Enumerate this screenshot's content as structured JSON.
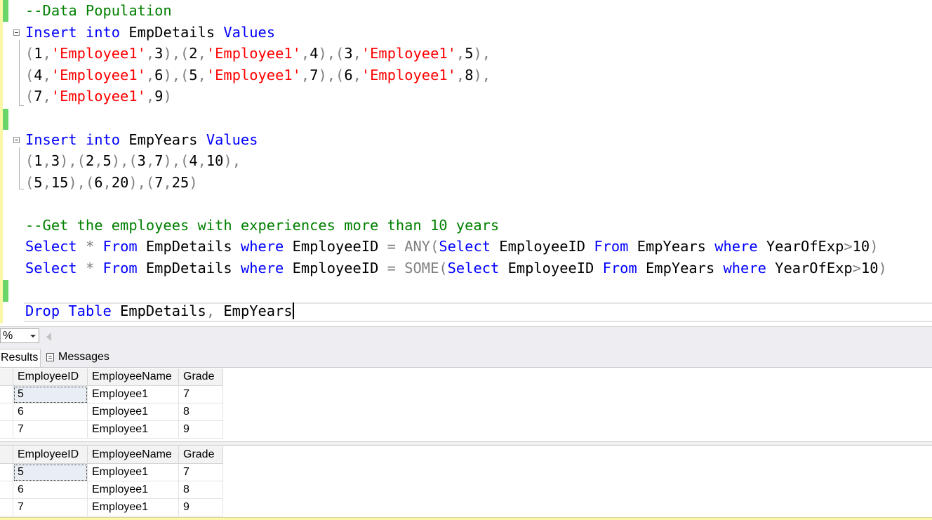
{
  "editor": {
    "lines": [
      [
        {
          "c": "cm",
          "t": "--Data Population"
        }
      ],
      [
        {
          "c": "kw",
          "t": "Insert"
        },
        {
          "c": "pl",
          "t": " "
        },
        {
          "c": "kw",
          "t": "into"
        },
        {
          "c": "pl",
          "t": " EmpDetails "
        },
        {
          "c": "kw",
          "t": "Values"
        }
      ],
      [
        {
          "c": "pun",
          "t": "("
        },
        {
          "c": "pl",
          "t": "1"
        },
        {
          "c": "pun",
          "t": ","
        },
        {
          "c": "str",
          "t": "'Employee1'"
        },
        {
          "c": "pun",
          "t": ","
        },
        {
          "c": "pl",
          "t": "3"
        },
        {
          "c": "pun",
          "t": "),("
        },
        {
          "c": "pl",
          "t": "2"
        },
        {
          "c": "pun",
          "t": ","
        },
        {
          "c": "str",
          "t": "'Employee1'"
        },
        {
          "c": "pun",
          "t": ","
        },
        {
          "c": "pl",
          "t": "4"
        },
        {
          "c": "pun",
          "t": "),("
        },
        {
          "c": "pl",
          "t": "3"
        },
        {
          "c": "pun",
          "t": ","
        },
        {
          "c": "str",
          "t": "'Employee1'"
        },
        {
          "c": "pun",
          "t": ","
        },
        {
          "c": "pl",
          "t": "5"
        },
        {
          "c": "pun",
          "t": "),"
        }
      ],
      [
        {
          "c": "pun",
          "t": "("
        },
        {
          "c": "pl",
          "t": "4"
        },
        {
          "c": "pun",
          "t": ","
        },
        {
          "c": "str",
          "t": "'Employee1'"
        },
        {
          "c": "pun",
          "t": ","
        },
        {
          "c": "pl",
          "t": "6"
        },
        {
          "c": "pun",
          "t": "),("
        },
        {
          "c": "pl",
          "t": "5"
        },
        {
          "c": "pun",
          "t": ","
        },
        {
          "c": "str",
          "t": "'Employee1'"
        },
        {
          "c": "pun",
          "t": ","
        },
        {
          "c": "pl",
          "t": "7"
        },
        {
          "c": "pun",
          "t": "),("
        },
        {
          "c": "pl",
          "t": "6"
        },
        {
          "c": "pun",
          "t": ","
        },
        {
          "c": "str",
          "t": "'Employee1'"
        },
        {
          "c": "pun",
          "t": ","
        },
        {
          "c": "pl",
          "t": "8"
        },
        {
          "c": "pun",
          "t": "),"
        }
      ],
      [
        {
          "c": "pun",
          "t": "("
        },
        {
          "c": "pl",
          "t": "7"
        },
        {
          "c": "pun",
          "t": ","
        },
        {
          "c": "str",
          "t": "'Employee1'"
        },
        {
          "c": "pun",
          "t": ","
        },
        {
          "c": "pl",
          "t": "9"
        },
        {
          "c": "pun",
          "t": ")"
        }
      ],
      [],
      [
        {
          "c": "kw",
          "t": "Insert"
        },
        {
          "c": "pl",
          "t": " "
        },
        {
          "c": "kw",
          "t": "into"
        },
        {
          "c": "pl",
          "t": " EmpYears "
        },
        {
          "c": "kw",
          "t": "Values"
        }
      ],
      [
        {
          "c": "pun",
          "t": "("
        },
        {
          "c": "pl",
          "t": "1"
        },
        {
          "c": "pun",
          "t": ","
        },
        {
          "c": "pl",
          "t": "3"
        },
        {
          "c": "pun",
          "t": "),("
        },
        {
          "c": "pl",
          "t": "2"
        },
        {
          "c": "pun",
          "t": ","
        },
        {
          "c": "pl",
          "t": "5"
        },
        {
          "c": "pun",
          "t": "),("
        },
        {
          "c": "pl",
          "t": "3"
        },
        {
          "c": "pun",
          "t": ","
        },
        {
          "c": "pl",
          "t": "7"
        },
        {
          "c": "pun",
          "t": "),("
        },
        {
          "c": "pl",
          "t": "4"
        },
        {
          "c": "pun",
          "t": ","
        },
        {
          "c": "pl",
          "t": "10"
        },
        {
          "c": "pun",
          "t": "),"
        }
      ],
      [
        {
          "c": "pun",
          "t": "("
        },
        {
          "c": "pl",
          "t": "5"
        },
        {
          "c": "pun",
          "t": ","
        },
        {
          "c": "pl",
          "t": "15"
        },
        {
          "c": "pun",
          "t": "),("
        },
        {
          "c": "pl",
          "t": "6"
        },
        {
          "c": "pun",
          "t": ","
        },
        {
          "c": "pl",
          "t": "20"
        },
        {
          "c": "pun",
          "t": "),("
        },
        {
          "c": "pl",
          "t": "7"
        },
        {
          "c": "pun",
          "t": ","
        },
        {
          "c": "pl",
          "t": "25"
        },
        {
          "c": "pun",
          "t": ")"
        }
      ],
      [],
      [
        {
          "c": "cm",
          "t": "--Get the employees with experiences more than 10 years"
        }
      ],
      [
        {
          "c": "kw",
          "t": "Select"
        },
        {
          "c": "pl",
          "t": " "
        },
        {
          "c": "pun",
          "t": "*"
        },
        {
          "c": "pl",
          "t": " "
        },
        {
          "c": "kw",
          "t": "From"
        },
        {
          "c": "pl",
          "t": " EmpDetails "
        },
        {
          "c": "kw",
          "t": "where"
        },
        {
          "c": "pl",
          "t": " EmployeeID "
        },
        {
          "c": "pun",
          "t": "="
        },
        {
          "c": "pl",
          "t": " "
        },
        {
          "c": "pun",
          "t": "ANY("
        },
        {
          "c": "kw",
          "t": "Select"
        },
        {
          "c": "pl",
          "t": " EmployeeID "
        },
        {
          "c": "kw",
          "t": "From"
        },
        {
          "c": "pl",
          "t": " EmpYears "
        },
        {
          "c": "kw",
          "t": "where"
        },
        {
          "c": "pl",
          "t": " YearOfExp"
        },
        {
          "c": "pun",
          "t": ">"
        },
        {
          "c": "pl",
          "t": "10"
        },
        {
          "c": "pun",
          "t": ")"
        }
      ],
      [
        {
          "c": "kw",
          "t": "Select"
        },
        {
          "c": "pl",
          "t": " "
        },
        {
          "c": "pun",
          "t": "*"
        },
        {
          "c": "pl",
          "t": " "
        },
        {
          "c": "kw",
          "t": "From"
        },
        {
          "c": "pl",
          "t": " EmpDetails "
        },
        {
          "c": "kw",
          "t": "where"
        },
        {
          "c": "pl",
          "t": " EmployeeID "
        },
        {
          "c": "pun",
          "t": "="
        },
        {
          "c": "pl",
          "t": " "
        },
        {
          "c": "pun",
          "t": "SOME("
        },
        {
          "c": "kw",
          "t": "Select"
        },
        {
          "c": "pl",
          "t": " EmployeeID "
        },
        {
          "c": "kw",
          "t": "From"
        },
        {
          "c": "pl",
          "t": " EmpYears "
        },
        {
          "c": "kw",
          "t": "where"
        },
        {
          "c": "pl",
          "t": " YearOfExp"
        },
        {
          "c": "pun",
          "t": ">"
        },
        {
          "c": "pl",
          "t": "10"
        },
        {
          "c": "pun",
          "t": ")"
        }
      ],
      [],
      [
        {
          "c": "kw",
          "t": "Drop"
        },
        {
          "c": "pl",
          "t": " "
        },
        {
          "c": "kw",
          "t": "Table"
        },
        {
          "c": "pl",
          "t": " EmpDetails"
        },
        {
          "c": "pun",
          "t": ","
        },
        {
          "c": "pl",
          "t": " EmpYears"
        }
      ]
    ],
    "line_names": [
      "comment-data-population",
      "insert-empdetails",
      "empdetails-values-1",
      "empdetails-values-2",
      "empdetails-values-3",
      "blank-1",
      "insert-empyears",
      "empyears-values-1",
      "empyears-values-2",
      "blank-2",
      "comment-get-employees",
      "select-any",
      "select-some",
      "blank-3",
      "drop-table"
    ]
  },
  "zoom": {
    "value": "%"
  },
  "tabs": {
    "results": "Results",
    "messages": "Messages"
  },
  "results": {
    "columns": [
      "EmployeeID",
      "EmployeeName",
      "Grade"
    ],
    "grids": [
      {
        "rows": [
          [
            "5",
            "Employee1",
            "7"
          ],
          [
            "6",
            "Employee1",
            "8"
          ],
          [
            "7",
            "Employee1",
            "9"
          ]
        ]
      },
      {
        "rows": [
          [
            "5",
            "Employee1",
            "7"
          ],
          [
            "6",
            "Employee1",
            "8"
          ],
          [
            "7",
            "Employee1",
            "9"
          ]
        ]
      }
    ]
  },
  "colors": {
    "comment": "#008000",
    "keyword": "#0000ff",
    "string": "#ff0000",
    "operator": "#808080",
    "change_saved": "#6ad66a",
    "change_unsaved": "#fbf7a6"
  }
}
